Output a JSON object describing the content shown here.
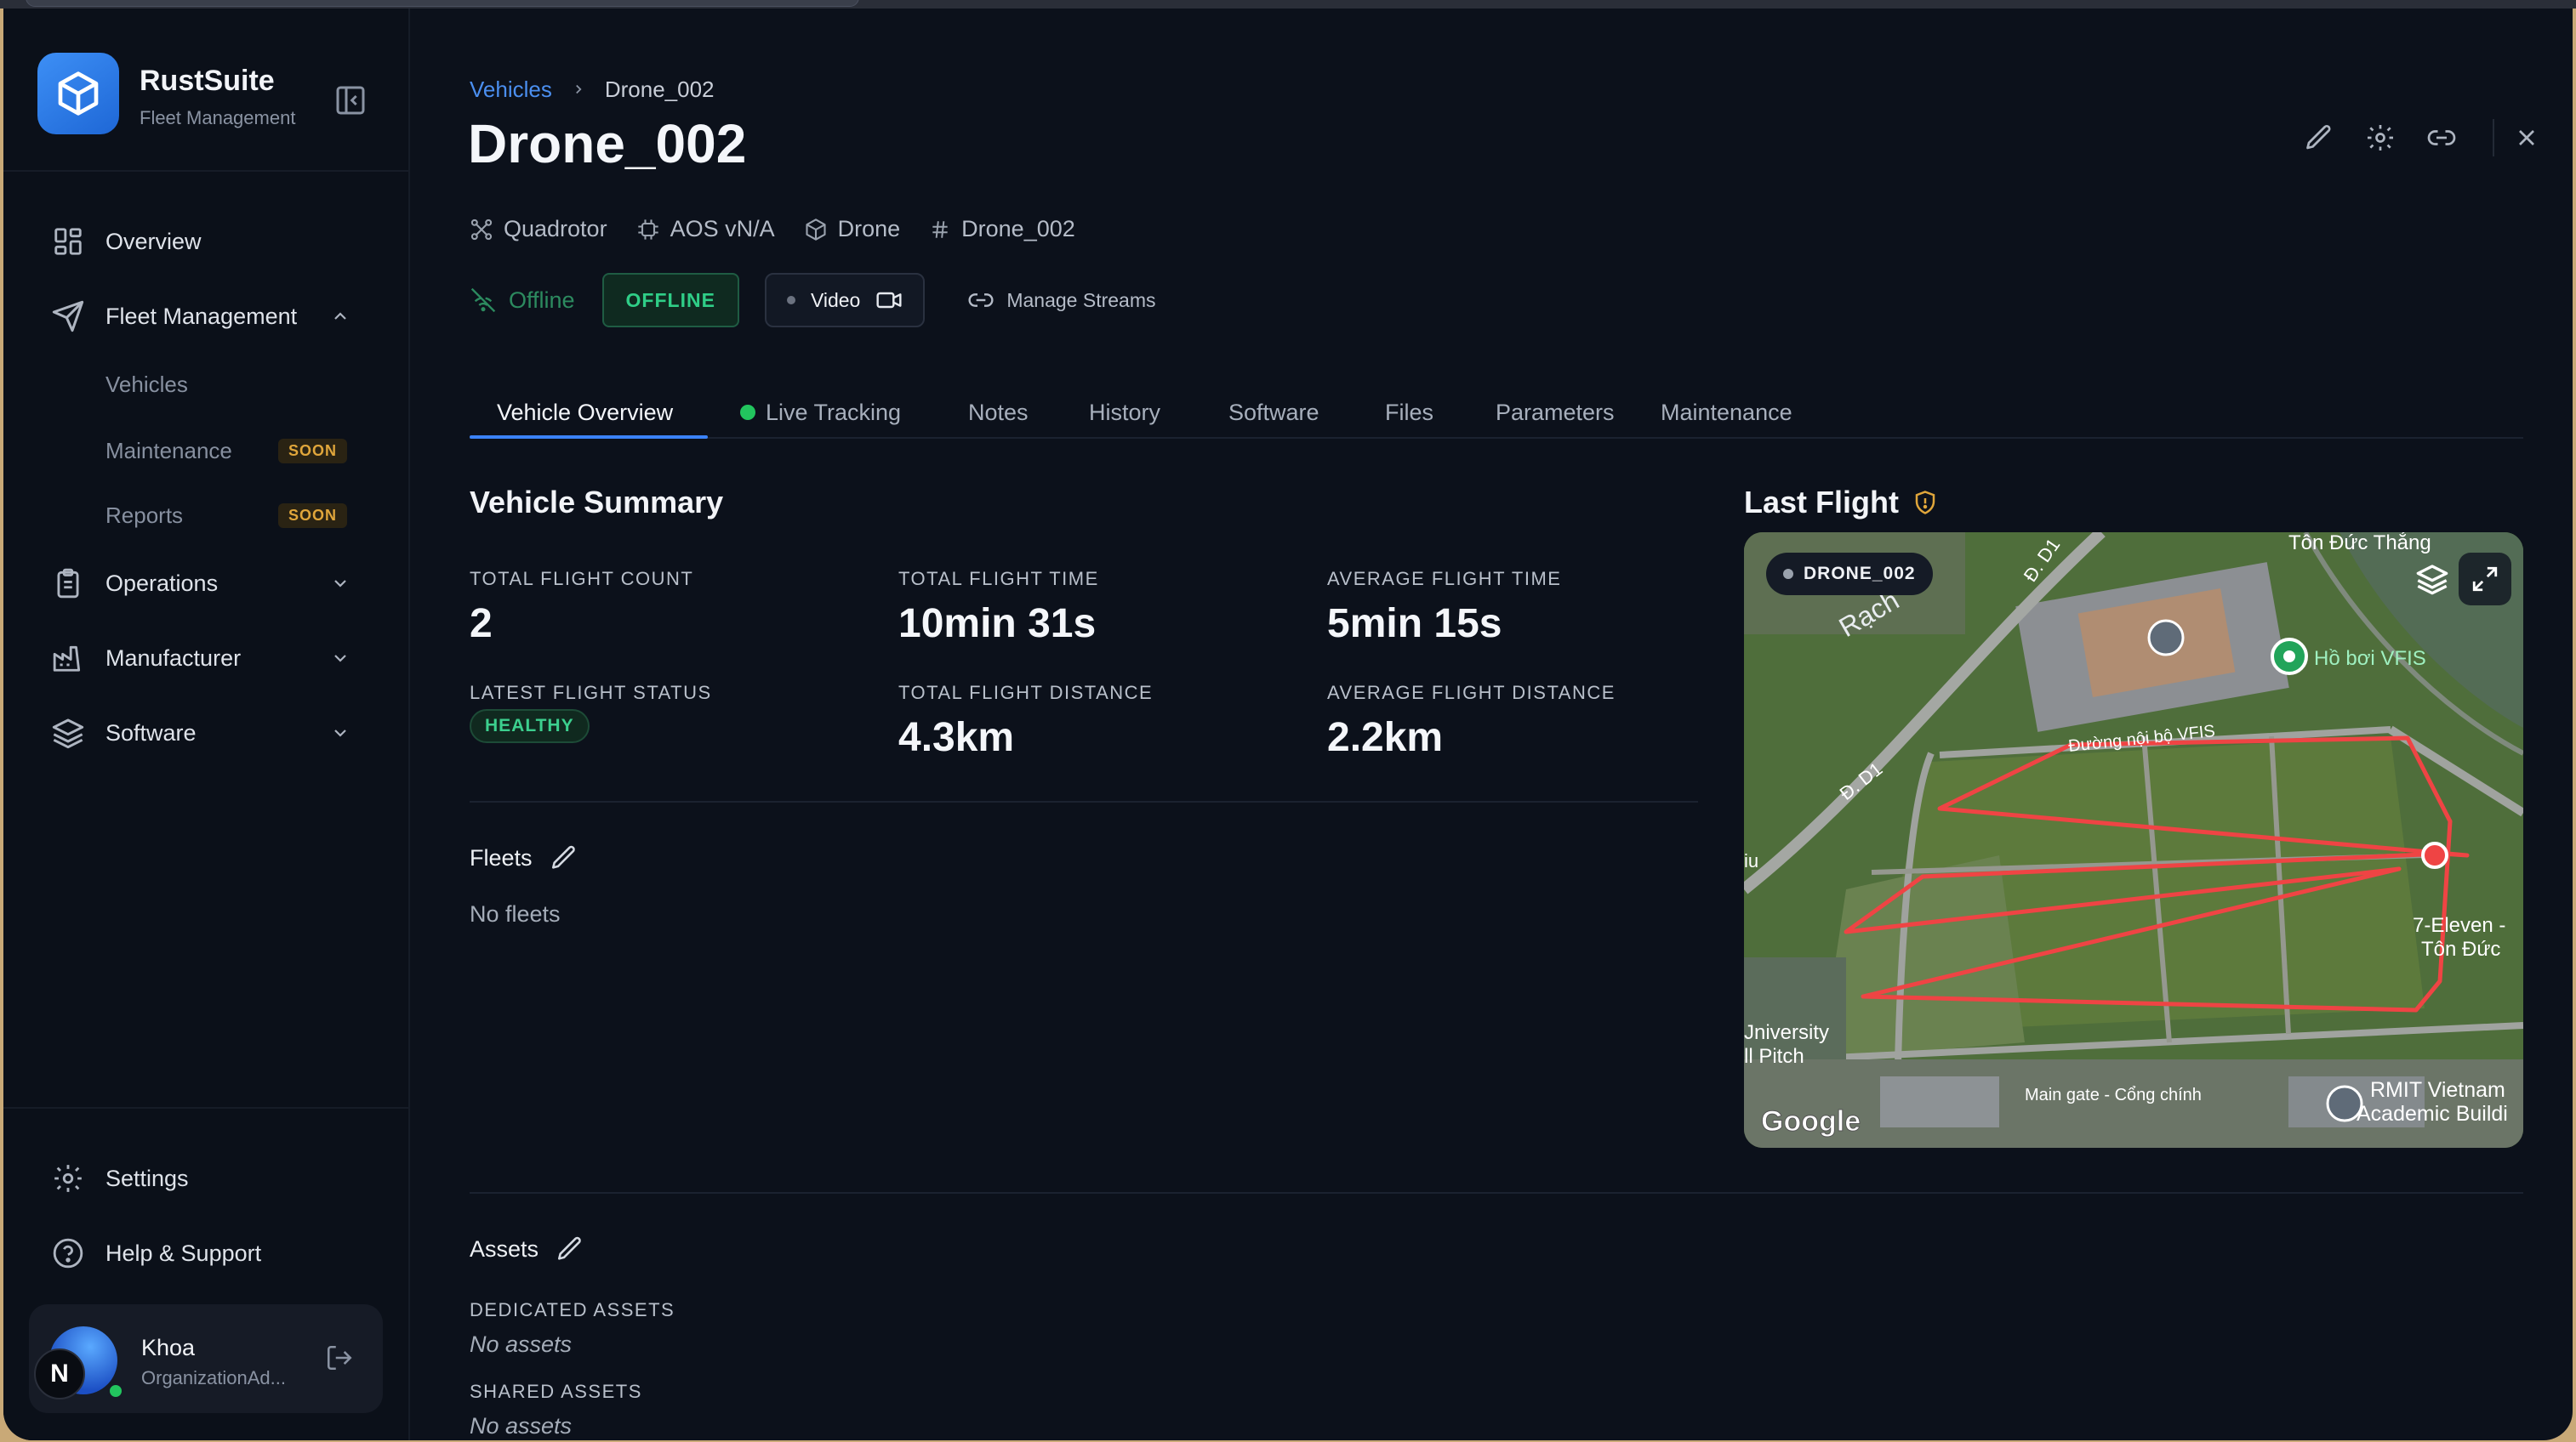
{
  "brand": {
    "name": "RustSuite",
    "subtitle": "Fleet Management"
  },
  "nav": {
    "overview": "Overview",
    "fleet_management": "Fleet Management",
    "fleet_sub": [
      {
        "label": "Vehicles"
      },
      {
        "label": "Maintenance",
        "badge": "SOON"
      },
      {
        "label": "Reports",
        "badge": "SOON"
      }
    ],
    "operations": "Operations",
    "manufacturer": "Manufacturer",
    "software": "Software",
    "settings": "Settings",
    "help": "Help & Support"
  },
  "user": {
    "name": "Khoa",
    "role": "OrganizationAd...",
    "initial": "N"
  },
  "breadcrumb": {
    "parent": "Vehicles",
    "current": "Drone_002"
  },
  "vehicle": {
    "title": "Drone_002",
    "type": "Quadrotor",
    "firmware": "AOS vN/A",
    "category": "Drone",
    "id": "Drone_002"
  },
  "status": {
    "connection": "Offline",
    "badge": "OFFLINE",
    "video_label": "Video",
    "manage_streams": "Manage Streams"
  },
  "tabs": [
    "Vehicle Overview",
    "Live Tracking",
    "Notes",
    "History",
    "Software",
    "Files",
    "Parameters",
    "Maintenance"
  ],
  "summary": {
    "title": "Vehicle Summary",
    "total_flight_count_label": "TOTAL FLIGHT COUNT",
    "total_flight_count": "2",
    "total_flight_time_label": "TOTAL FLIGHT TIME",
    "total_flight_time": "10min 31s",
    "avg_flight_time_label": "AVERAGE FLIGHT TIME",
    "avg_flight_time": "5min 15s",
    "latest_status_label": "LATEST FLIGHT STATUS",
    "latest_status": "HEALTHY",
    "total_distance_label": "TOTAL FLIGHT DISTANCE",
    "total_distance": "4.3km",
    "avg_distance_label": "AVERAGE FLIGHT DISTANCE",
    "avg_distance": "2.2km"
  },
  "fleets": {
    "title": "Fleets",
    "empty": "No fleets"
  },
  "assets": {
    "title": "Assets",
    "dedicated_label": "DEDICATED ASSETS",
    "dedicated_empty": "No assets",
    "shared_label": "SHARED ASSETS",
    "shared_empty": "No assets"
  },
  "last_flight": {
    "title": "Last Flight",
    "map_badge": "DRONE_002",
    "map_labels": {
      "ton_duc_thang": "Tôn Đức Thắng",
      "ho_boi": "Hồ bơi VFIS",
      "duong_noi_bo": "Đường nội bộ VFIS",
      "d_d1_top": "Đ. D1",
      "d_d1_left": "Đ. D1",
      "rach": "Rạch",
      "seven_eleven": "7-Eleven -",
      "ton_duc_short": "Tôn Đức",
      "university": "Jniversity",
      "pitch": "ll Pitch",
      "main_gate": "Main gate - Cổng chính",
      "rmit": "RMIT Vietnam",
      "academic": "Academic Buildi",
      "google": "Google",
      "left_edge": "iu"
    }
  },
  "colors": {
    "accent": "#3b82f6",
    "success": "#22c55e",
    "warning": "#e0a63b",
    "track": "#ef4444"
  }
}
